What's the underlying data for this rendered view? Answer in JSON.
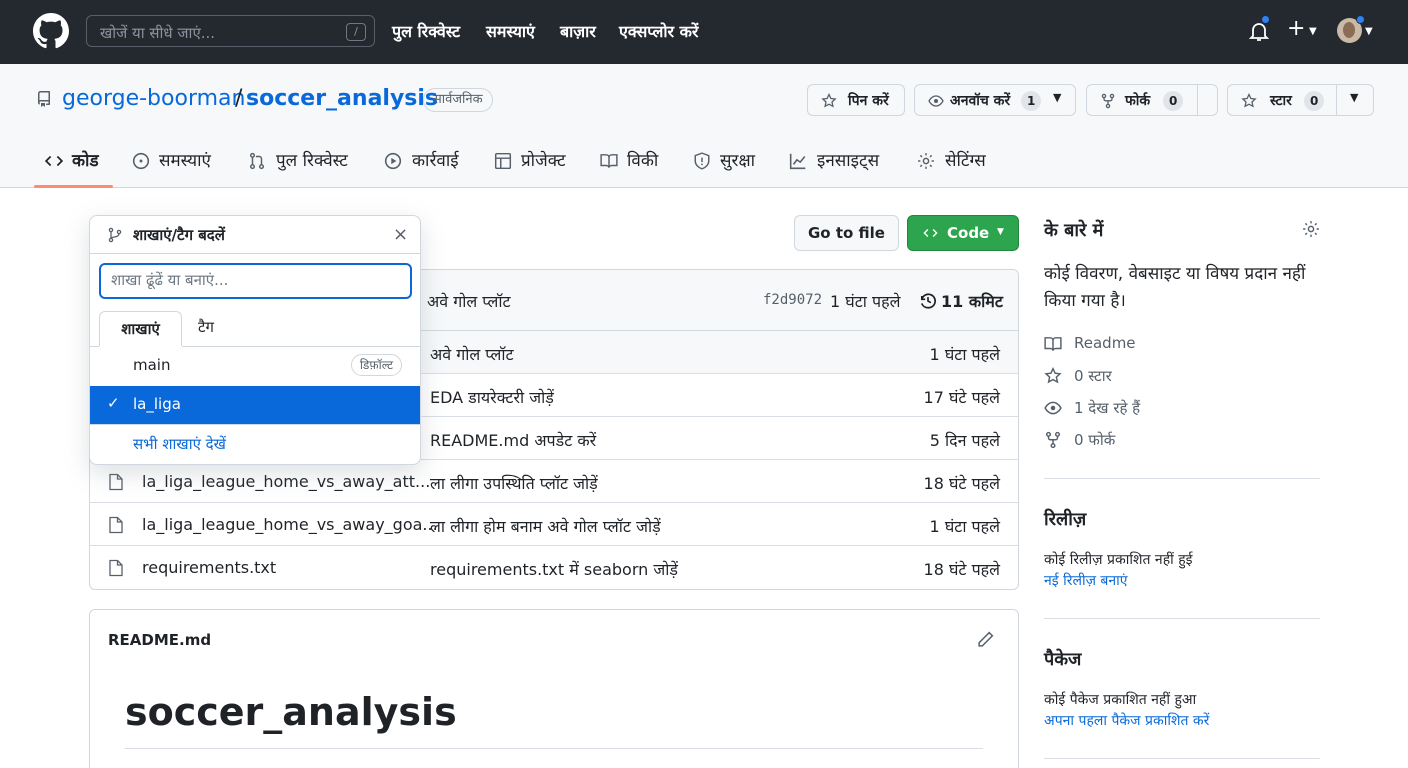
{
  "topbar": {
    "search_placeholder": "खोजें या सीधे जाएं...",
    "slash_key": "/",
    "nav": [
      "पुल रिक्वेस्ट",
      "समस्याएं",
      "बाज़ार",
      "एक्सप्लोर करें"
    ]
  },
  "repo": {
    "owner": "george-boorman",
    "separator": "/",
    "name": "soccer_analysis",
    "visibility": "सार्वजनिक",
    "pin_label": "पिन करें",
    "watch_label": "अनवॉच करें",
    "watch_count": "1",
    "fork_label": "फोर्क",
    "fork_count": "0",
    "star_label": "स्टार",
    "star_count": "0"
  },
  "tabs": [
    "कोड",
    "समस्याएं",
    "पुल रिक्वेस्ट",
    "कार्रवाई",
    "प्रोजेक्ट",
    "विकी",
    "सुरक्षा",
    "इनसाइट्स",
    "सेटिंग्स"
  ],
  "actions": {
    "go_to_file": "Go to file",
    "code": "Code"
  },
  "commit_bar": {
    "message": "अवे गोल प्लॉट",
    "sha": "f2d9072",
    "time": "1 घंटा पहले",
    "commits": "11 कमिट"
  },
  "files": [
    {
      "name": "",
      "message": "अवे गोल प्लॉट",
      "time": "1 घंटा पहले"
    },
    {
      "name": "",
      "message": "EDA डायरेक्टरी जोड़ें",
      "time": "17 घंटे पहले"
    },
    {
      "name": "",
      "message": "README.md अपडेट करें",
      "time": "5 दिन पहले"
    },
    {
      "name": "la_liga_league_home_vs_away_att...",
      "message": "ला लीगा उपस्थिति प्लॉट जोड़ें",
      "time": "18 घंटे पहले"
    },
    {
      "name": "la_liga_league_home_vs_away_goa...",
      "message": "ला लीगा होम बनाम अवे गोल प्लॉट जोड़ें",
      "time": "1 घंटा पहले"
    },
    {
      "name": "requirements.txt",
      "message": "requirements.txt में seaborn जोड़ें",
      "time": "18 घंटे पहले"
    }
  ],
  "dropdown": {
    "title": "शाखाएं/टैग बदलें",
    "close": "×",
    "placeholder": "शाखा ढूंढें या बनाएं...",
    "tab_branches": "शाखाएं",
    "tab_tags": "टैग",
    "branches": [
      {
        "name": "main",
        "badge": "डिफ़ॉल्ट"
      },
      {
        "name": "la_liga",
        "check": "✓"
      }
    ],
    "view_all": "सभी शाखाएं देखें"
  },
  "readme": {
    "filename": "README.md",
    "heading": "soccer_analysis"
  },
  "sidebar": {
    "about_title": "के बारे में",
    "about_text": "कोई विवरण, वेबसाइट या विषय प्रदान नहीं किया गया है।",
    "readme": "Readme",
    "stars": "0 स्टार",
    "watching": "1 देख रहे हैं",
    "forks": "0 फोर्क",
    "releases_title": "रिलीज़",
    "releases_none": "कोई रिलीज़ प्रकाशित नहीं हुई",
    "releases_link": "नई रिलीज़ बनाएं",
    "packages_title": "पैकेज",
    "packages_none": "कोई पैकेज प्रकाशित नहीं हुआ",
    "packages_link": "अपना पहला पैकेज प्रकाशित करें"
  },
  "colors": {
    "topbar": "#24292f",
    "accent": "#0969da",
    "code_button": "#2da44e",
    "tab_underline": "#fd8c73",
    "notification_dot": "#2f81f7"
  }
}
